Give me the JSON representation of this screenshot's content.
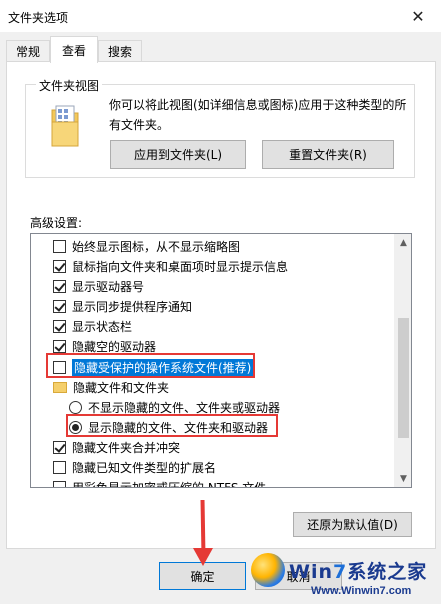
{
  "window": {
    "title": "文件夹选项",
    "close_glyph": "✕"
  },
  "tabs": [
    {
      "label": "常规",
      "active": false
    },
    {
      "label": "查看",
      "active": true
    },
    {
      "label": "搜索",
      "active": false
    }
  ],
  "folder_views": {
    "group_title": "文件夹视图",
    "description": "你可以将此视图(如详细信息或图标)应用于这种类型的所有文件夹。",
    "apply_button": "应用到文件夹(L)",
    "reset_button": "重置文件夹(R)"
  },
  "advanced": {
    "label": "高级设置:",
    "items": [
      {
        "type": "checkbox",
        "checked": false,
        "label": "始终显示图标，从不显示缩略图"
      },
      {
        "type": "checkbox",
        "checked": true,
        "label": "鼠标指向文件夹和桌面项时显示提示信息"
      },
      {
        "type": "checkbox",
        "checked": true,
        "label": "显示驱动器号"
      },
      {
        "type": "checkbox",
        "checked": true,
        "label": "显示同步提供程序通知"
      },
      {
        "type": "checkbox",
        "checked": true,
        "label": "显示状态栏"
      },
      {
        "type": "checkbox",
        "checked": true,
        "label": "隐藏空的驱动器"
      },
      {
        "type": "checkbox",
        "checked": false,
        "label": "隐藏受保护的操作系统文件(推荐)",
        "selected": true
      },
      {
        "type": "folder",
        "label": "隐藏文件和文件夹"
      },
      {
        "type": "radio",
        "checked": false,
        "label": "不显示隐藏的文件、文件夹或驱动器"
      },
      {
        "type": "radio",
        "checked": true,
        "label": "显示隐藏的文件、文件夹和驱动器"
      },
      {
        "type": "checkbox",
        "checked": true,
        "label": "隐藏文件夹合并冲突"
      },
      {
        "type": "checkbox",
        "checked": false,
        "label": "隐藏已知文件类型的扩展名"
      },
      {
        "type": "checkbox",
        "checked": false,
        "label": "用彩色显示加密或压缩的 NTFS 文件"
      }
    ],
    "restore_button": "还原为默认值(D)"
  },
  "footer": {
    "ok_button": "确定",
    "cancel_button": "取消"
  },
  "watermark": {
    "brand_prefix": "Win",
    "brand_seven": "7",
    "brand_suffix": "系统之家",
    "url": "Www.Winwin7.com"
  },
  "colors": {
    "annotation": "#e53935",
    "selection": "#0078d7"
  }
}
